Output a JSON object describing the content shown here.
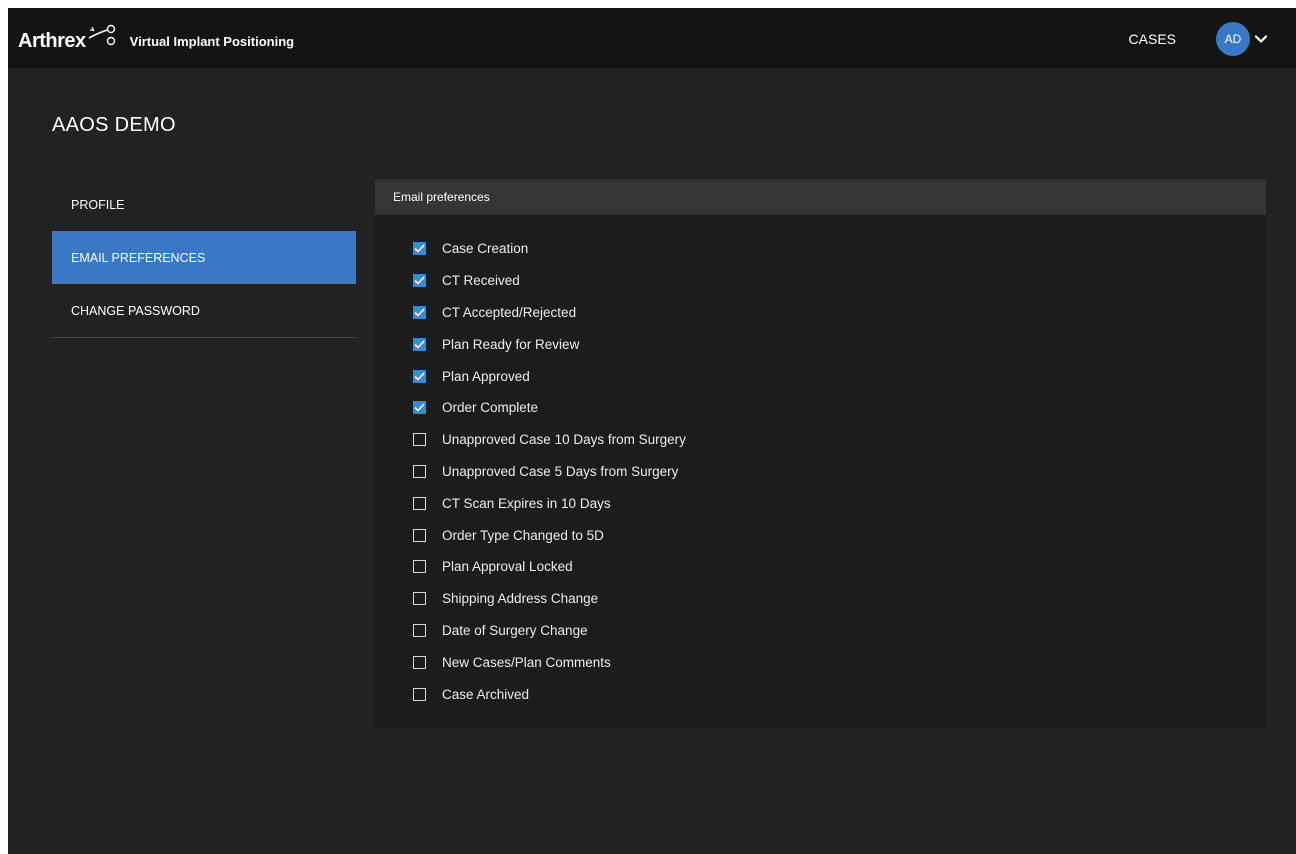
{
  "header": {
    "brand": "Arthrex",
    "product": "Virtual Implant Positioning",
    "nav_cases": "CASES",
    "avatar_initials": "AD"
  },
  "page": {
    "title": "AAOS DEMO"
  },
  "sidebar": {
    "items": [
      {
        "label": "PROFILE",
        "active": false
      },
      {
        "label": "EMAIL PREFERENCES",
        "active": true
      },
      {
        "label": "CHANGE PASSWORD",
        "active": false
      }
    ]
  },
  "panel": {
    "header": "Email preferences",
    "preferences": [
      {
        "label": "Case Creation",
        "checked": true
      },
      {
        "label": "CT Received",
        "checked": true
      },
      {
        "label": "CT Accepted/Rejected",
        "checked": true
      },
      {
        "label": "Plan Ready for Review",
        "checked": true
      },
      {
        "label": "Plan Approved",
        "checked": true
      },
      {
        "label": "Order Complete",
        "checked": true
      },
      {
        "label": "Unapproved Case 10 Days from Surgery",
        "checked": false
      },
      {
        "label": "Unapproved Case 5 Days from Surgery",
        "checked": false
      },
      {
        "label": "CT Scan Expires in 10 Days",
        "checked": false
      },
      {
        "label": "Order Type Changed to 5D",
        "checked": false
      },
      {
        "label": "Plan Approval Locked",
        "checked": false
      },
      {
        "label": "Shipping Address Change",
        "checked": false
      },
      {
        "label": "Date of Surgery Change",
        "checked": false
      },
      {
        "label": "New Cases/Plan Comments",
        "checked": false
      },
      {
        "label": "Case Archived",
        "checked": false
      }
    ]
  },
  "colors": {
    "accent": "#3a78c6",
    "checkbox_checked": "#3a8ad1",
    "background": "#222222",
    "topbar": "#141414",
    "panel": "#1c1c1c",
    "panel_header": "#353535"
  },
  "icons": {
    "logo": "arthrex-logo-icon",
    "user_menu": "chevron-down-icon",
    "checked": "checkmark-icon"
  }
}
